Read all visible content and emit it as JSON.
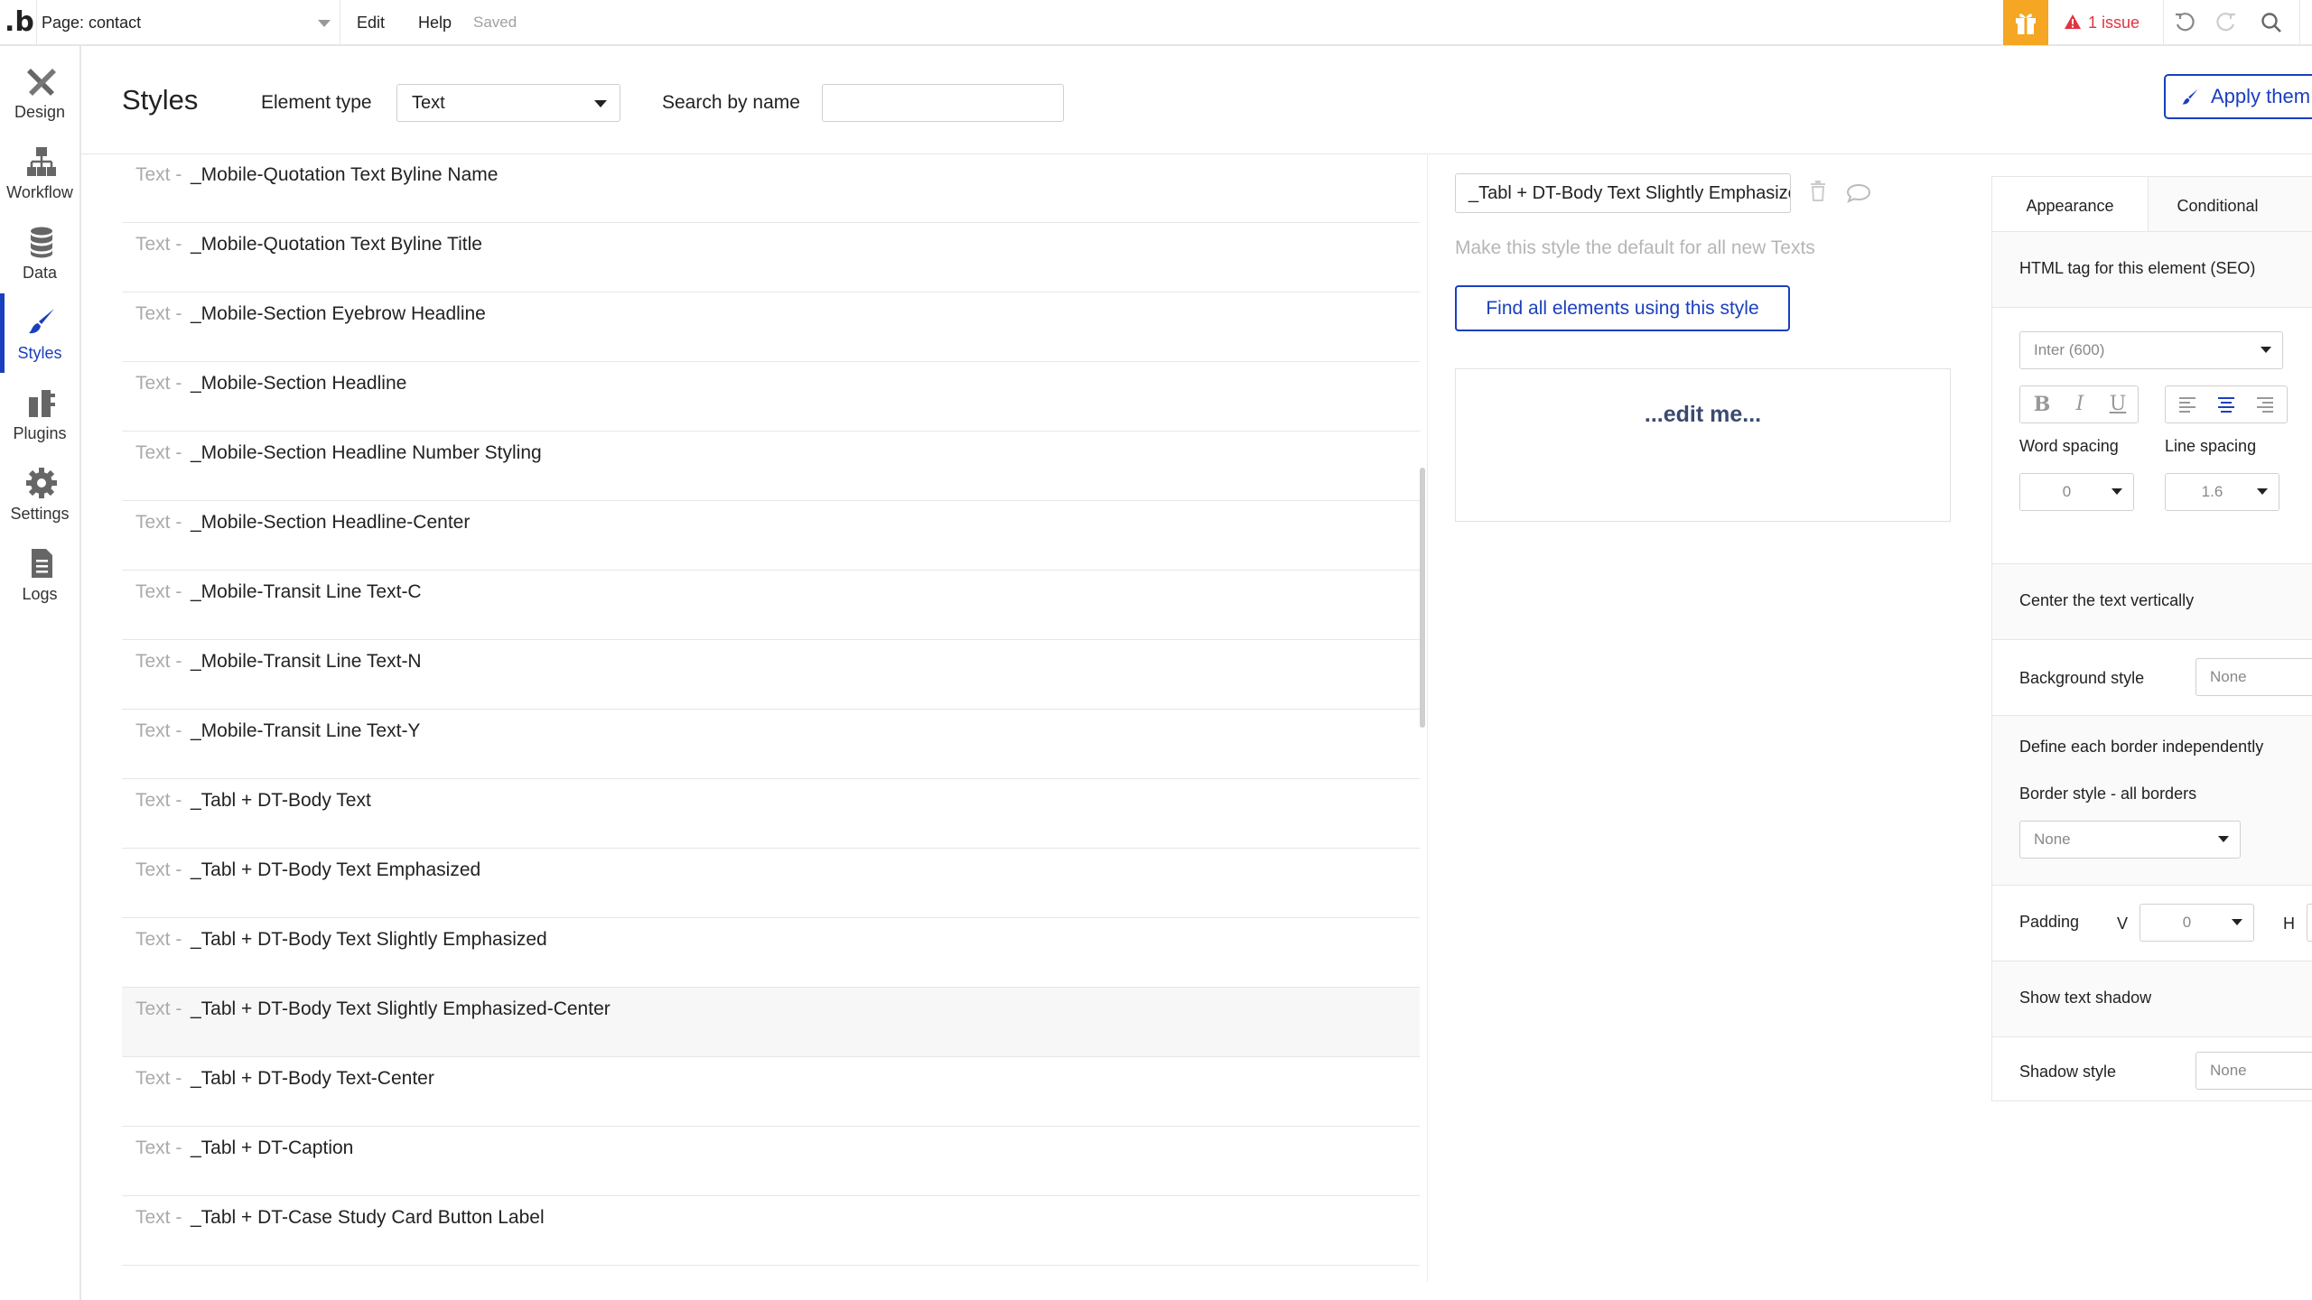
{
  "topbar": {
    "logo": ".b",
    "page_label": "Page: contact",
    "menu_edit": "Edit",
    "menu_help": "Help",
    "saved": "Saved",
    "issues": "1 issue",
    "colors": {
      "accent": "#1a3fbe",
      "gift": "#f5a623",
      "issue": "#e0343f"
    }
  },
  "sidebar": {
    "items": [
      {
        "label": "Design",
        "icon": "design-icon"
      },
      {
        "label": "Workflow",
        "icon": "workflow-icon"
      },
      {
        "label": "Data",
        "icon": "database-icon"
      },
      {
        "label": "Styles",
        "icon": "brush-icon",
        "active": true
      },
      {
        "label": "Plugins",
        "icon": "plugins-icon"
      },
      {
        "label": "Settings",
        "icon": "gear-icon"
      },
      {
        "label": "Logs",
        "icon": "document-icon"
      }
    ]
  },
  "header": {
    "title": "Styles",
    "element_type_label": "Element type",
    "element_type_value": "Text",
    "search_label": "Search by name",
    "search_value": "",
    "apply_button": "Apply them"
  },
  "styles_list": {
    "prefix": "Text -",
    "items": [
      "_Mobile-Quotation Text Byline Name",
      "_Mobile-Quotation Text Byline Title",
      "_Mobile-Section Eyebrow Headline",
      "_Mobile-Section Headline",
      "_Mobile-Section Headline Number Styling",
      "_Mobile-Section Headline-Center",
      "_Mobile-Transit Line Text-C",
      "_Mobile-Transit Line Text-N",
      "_Mobile-Transit Line Text-Y",
      "_Tabl + DT-Body Text",
      "_Tabl + DT-Body Text Emphasized",
      "_Tabl + DT-Body Text Slightly Emphasized",
      "_Tabl + DT-Body Text Slightly Emphasized-Center",
      "_Tabl + DT-Body Text-Center",
      "_Tabl + DT-Caption",
      "_Tabl + DT-Case Study Card Button Label"
    ],
    "hovered_index": 12
  },
  "detail": {
    "style_name": "_Tabl + DT-Body Text Slightly Emphasized-Center",
    "make_default": "Make this style the default for all new Texts",
    "find_button": "Find all elements using this style",
    "preview_text": "...edit me..."
  },
  "properties": {
    "tabs": [
      "Appearance",
      "Conditional"
    ],
    "html_tag_label": "HTML tag for this element (SEO)",
    "font_value": "Inter (600)",
    "format_buttons": [
      "B",
      "I",
      "U"
    ],
    "word_spacing_label": "Word spacing",
    "word_spacing_value": "0",
    "line_spacing_label": "Line spacing",
    "line_spacing_value": "1.6",
    "center_vertical_label": "Center the text vertically",
    "background_style_label": "Background style",
    "background_style_value": "None",
    "border_independent_label": "Define each border independently",
    "border_style_label": "Border style - all borders",
    "border_style_value": "None",
    "padding_label": "Padding",
    "padding_v_label": "V",
    "padding_v_value": "0",
    "padding_h_label": "H",
    "show_shadow_label": "Show text shadow",
    "shadow_style_label": "Shadow style",
    "shadow_style_value": "None"
  }
}
